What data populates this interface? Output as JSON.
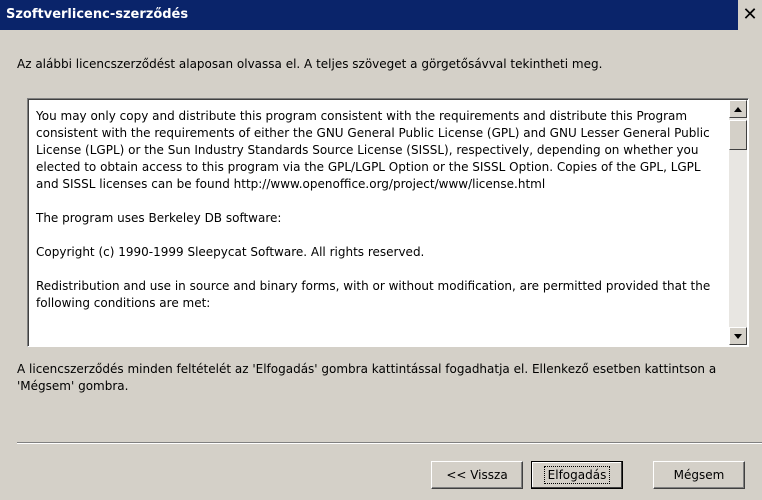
{
  "window": {
    "title": "Szoftverlicenc-szerződés",
    "close_glyph": "✕"
  },
  "intro": "Az alábbi licencszerződést alaposan olvassa el. A teljes szöveget a görgetősávval tekintheti meg.",
  "license": {
    "paragraphs": [
      "You may only copy and distribute this program consistent with the requirements and distribute this Program consistent with the requirements of either the GNU General Public License (GPL) and GNU Lesser General Public License (LGPL) or the Sun Industry Standards Source License (SISSL), respectively, depending on whether you elected to obtain access to this program via the GPL/LGPL Option or the SISSL Option. Copies of the GPL, LGPL and SISSL licenses can be found http://www.openoffice.org/project/www/license.html",
      "The program uses Berkeley DB software:",
      "Copyright (c) 1990-1999 Sleepycat Software.  All rights reserved.",
      "Redistribution and use in source and binary forms, with or without modification, are permitted provided that the following conditions are met:"
    ]
  },
  "footer_text": "A licencszerződés minden feltételét az 'Elfogadás' gombra kattintással fogadhatja el. Ellenkező esetben kattintson a 'Mégsem' gombra.",
  "buttons": {
    "back": "<< Vissza",
    "accept": "Elfogadás",
    "cancel": "Mégsem"
  },
  "colors": {
    "titlebar": "#0a246a",
    "dialog_bg": "#d4d0c8"
  }
}
